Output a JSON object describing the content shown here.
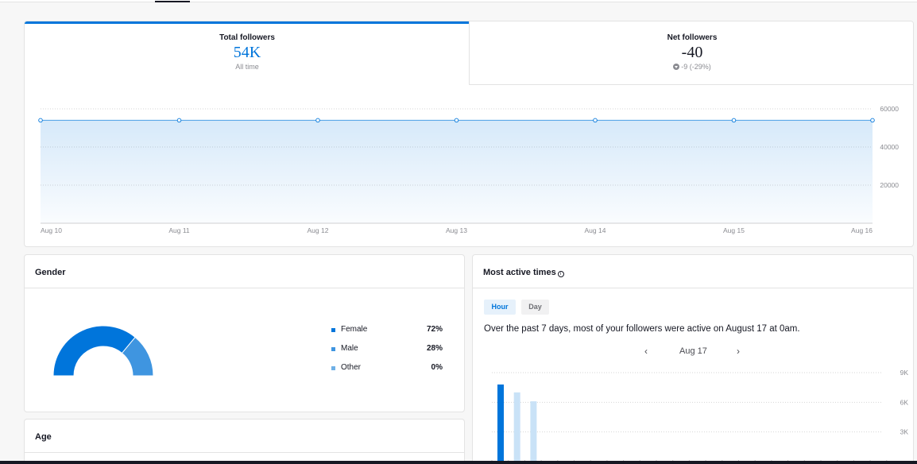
{
  "overview": {
    "total": {
      "label": "Total followers",
      "value": "54K",
      "sub": "All time"
    },
    "net": {
      "label": "Net followers",
      "value": "-40",
      "sub": "-9 (-29%)"
    }
  },
  "gender": {
    "title": "Gender",
    "items": [
      {
        "name": "Female",
        "percent": "72%",
        "value": 72,
        "color": "#0075db"
      },
      {
        "name": "Male",
        "percent": "28%",
        "value": 28,
        "color": "#3f95e0"
      },
      {
        "name": "Other",
        "percent": "0%",
        "value": 0,
        "color": "#6fb0e6"
      }
    ]
  },
  "age": {
    "title": "Age"
  },
  "active_times": {
    "title": "Most active times",
    "tabs": {
      "hour": "Hour",
      "day": "Day"
    },
    "summary": "Over the past 7 days, most of your followers were active on August 17 at 0am.",
    "date": "Aug 17",
    "prev": "‹",
    "next": "›"
  },
  "chart_data": [
    {
      "type": "area",
      "title": "",
      "categories": [
        "Aug 10",
        "Aug 11",
        "Aug 12",
        "Aug 13",
        "Aug 14",
        "Aug 15",
        "Aug 16"
      ],
      "values": [
        54000,
        54000,
        54000,
        54000,
        54000,
        54000,
        54000
      ],
      "ylim": [
        0,
        60000
      ],
      "yticks": [
        20000,
        40000,
        60000
      ],
      "ytick_labels": [
        "20000",
        "40000",
        "60000"
      ],
      "grid": true,
      "color": "#0075db"
    },
    {
      "type": "bar",
      "title": "",
      "x": [
        0,
        1,
        2
      ],
      "values": [
        7800,
        7000,
        6100
      ],
      "highlight_index": 0,
      "ylim": [
        0,
        9000
      ],
      "yticks": [
        3000,
        6000,
        9000
      ],
      "ytick_labels": [
        "3K",
        "6K",
        "9K"
      ],
      "colors": {
        "highlight": "#0075db",
        "normal": "#c9e2f7"
      }
    }
  ]
}
